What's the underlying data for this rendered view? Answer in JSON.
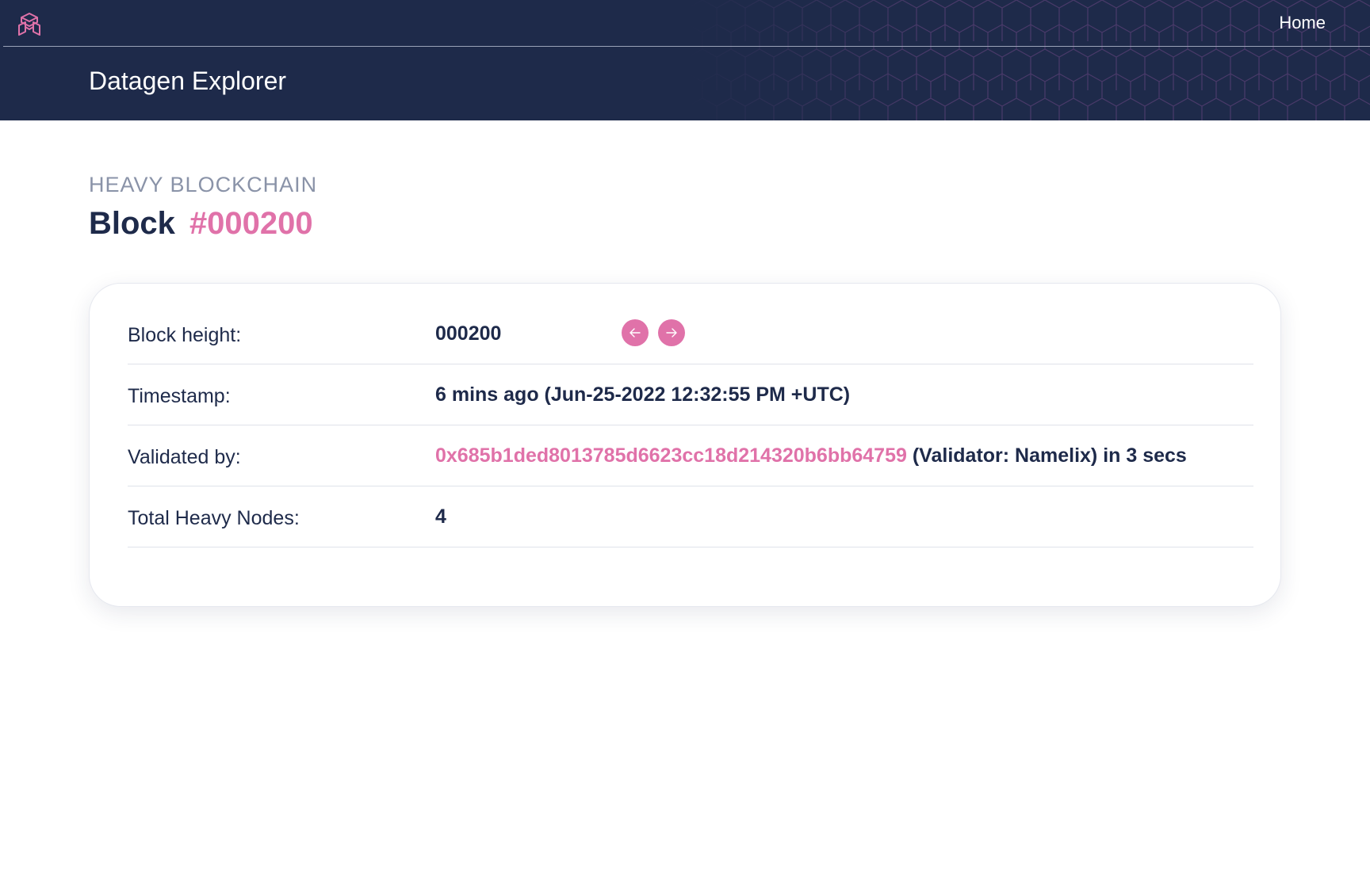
{
  "nav": {
    "home_label": "Home"
  },
  "header": {
    "title": "Datagen Explorer"
  },
  "page": {
    "eyebrow": "HEAVY BLOCKCHAIN",
    "title_prefix": "Block",
    "title_number": "#000200"
  },
  "details": {
    "block_height": {
      "label": "Block height:",
      "value": "000200"
    },
    "timestamp": {
      "label": "Timestamp:",
      "value": "6 mins ago (Jun-25-2022 12:32:55 PM +UTC)"
    },
    "validated_by": {
      "label": "Validated by:",
      "hash": "0x685b1ded8013785d6623cc18d214320b6bb64759",
      "suffix": " (Validator: Namelix) in 3 secs"
    },
    "total_nodes": {
      "label": "Total Heavy Nodes:",
      "value": "4"
    }
  },
  "colors": {
    "navy": "#1e2a4a",
    "accent": "#e072a9",
    "muted": "#8a93a8"
  },
  "icons": {
    "logo": "cube-logo-icon",
    "prev": "arrow-left-icon",
    "next": "arrow-right-icon"
  }
}
